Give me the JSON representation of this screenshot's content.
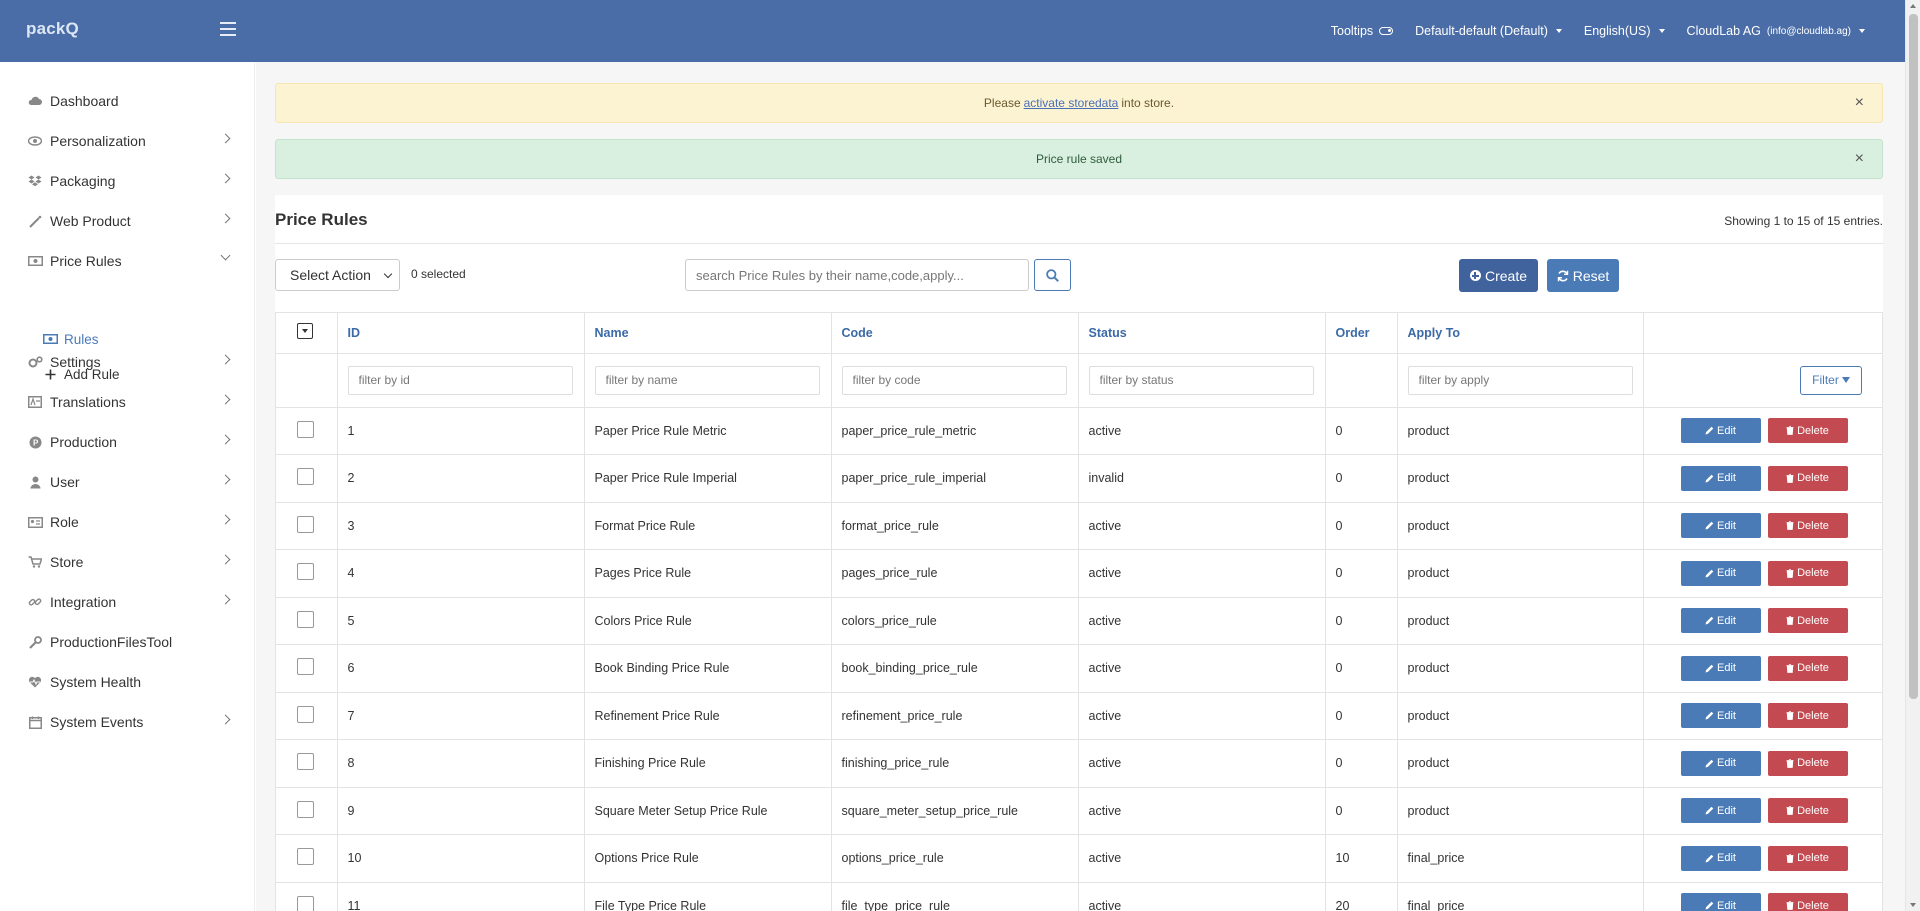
{
  "header": {
    "logo": "packQ",
    "tooltips_label": "Tooltips",
    "store_selector": "Default-default (Default)",
    "language": "English(US)",
    "account_name": "CloudLab AG",
    "account_email": "(info@cloudlab.ag)"
  },
  "sidebar": {
    "items": [
      {
        "label": "Dashboard",
        "icon": "cloud-icon"
      },
      {
        "label": "Personalization",
        "icon": "eye-icon"
      },
      {
        "label": "Packaging",
        "icon": "dropbox-icon"
      },
      {
        "label": "Web Product",
        "icon": "magic-wand-icon"
      },
      {
        "label": "Price Rules",
        "icon": "money-icon"
      },
      {
        "label": "Settings",
        "icon": "cogs-icon"
      },
      {
        "label": "Translations",
        "icon": "language-icon"
      },
      {
        "label": "Production",
        "icon": "production-icon"
      },
      {
        "label": "User",
        "icon": "user-icon"
      },
      {
        "label": "Role",
        "icon": "id-card-icon"
      },
      {
        "label": "Store",
        "icon": "cart-icon"
      },
      {
        "label": "Integration",
        "icon": "link-icon"
      },
      {
        "label": "ProductionFilesTool",
        "icon": "wrench-icon"
      },
      {
        "label": "System Health",
        "icon": "heartbeat-icon"
      },
      {
        "label": "System Events",
        "icon": "calendar-icon"
      }
    ],
    "sub_items": [
      {
        "label": "Rules",
        "icon": "money-icon"
      },
      {
        "label": "Add Rule",
        "icon": "plus-icon"
      }
    ]
  },
  "alerts": {
    "warning_prefix": "Please",
    "warning_link": "activate storedata",
    "warning_suffix": "into store.",
    "success": "Price rule saved"
  },
  "page": {
    "title": "Price Rules",
    "showing": "Showing 1 to 15 of 15 entries.",
    "select_action": "Select Action",
    "selected_count": "0 selected",
    "search_placeholder": "search Price Rules by their name,code,apply...",
    "create_label": "Create",
    "reset_label": "Reset"
  },
  "table": {
    "headers": {
      "id": "ID",
      "name": "Name",
      "code": "Code",
      "status": "Status",
      "order": "Order",
      "apply": "Apply To"
    },
    "filters": {
      "id": "filter by id",
      "name": "filter by name",
      "code": "filter by code",
      "status": "filter by status",
      "apply": "filter by apply",
      "button": "Filter"
    },
    "edit_label": "Edit",
    "delete_label": "Delete",
    "rows": [
      {
        "id": "1",
        "name": "Paper Price Rule Metric",
        "code": "paper_price_rule_metric",
        "status": "active",
        "order": "0",
        "apply": "product"
      },
      {
        "id": "2",
        "name": "Paper Price Rule Imperial",
        "code": "paper_price_rule_imperial",
        "status": "invalid",
        "order": "0",
        "apply": "product"
      },
      {
        "id": "3",
        "name": "Format Price Rule",
        "code": "format_price_rule",
        "status": "active",
        "order": "0",
        "apply": "product"
      },
      {
        "id": "4",
        "name": "Pages Price Rule",
        "code": "pages_price_rule",
        "status": "active",
        "order": "0",
        "apply": "product"
      },
      {
        "id": "5",
        "name": "Colors Price Rule",
        "code": "colors_price_rule",
        "status": "active",
        "order": "0",
        "apply": "product"
      },
      {
        "id": "6",
        "name": "Book Binding Price Rule",
        "code": "book_binding_price_rule",
        "status": "active",
        "order": "0",
        "apply": "product"
      },
      {
        "id": "7",
        "name": "Refinement Price Rule",
        "code": "refinement_price_rule",
        "status": "active",
        "order": "0",
        "apply": "product"
      },
      {
        "id": "8",
        "name": "Finishing Price Rule",
        "code": "finishing_price_rule",
        "status": "active",
        "order": "0",
        "apply": "product"
      },
      {
        "id": "9",
        "name": "Square Meter Setup Price Rule",
        "code": "square_meter_setup_price_rule",
        "status": "active",
        "order": "0",
        "apply": "product"
      },
      {
        "id": "10",
        "name": "Options Price Rule",
        "code": "options_price_rule",
        "status": "active",
        "order": "10",
        "apply": "final_price"
      },
      {
        "id": "11",
        "name": "File Type Price Rule",
        "code": "file_type_price_rule",
        "status": "active",
        "order": "20",
        "apply": "final_price"
      }
    ]
  },
  "colors": {
    "header_bg": "#4a6da7",
    "primary": "#4a7bb7",
    "danger": "#c24a50",
    "warning_bg": "#fcf3d3",
    "success_bg": "#d9efe0"
  }
}
